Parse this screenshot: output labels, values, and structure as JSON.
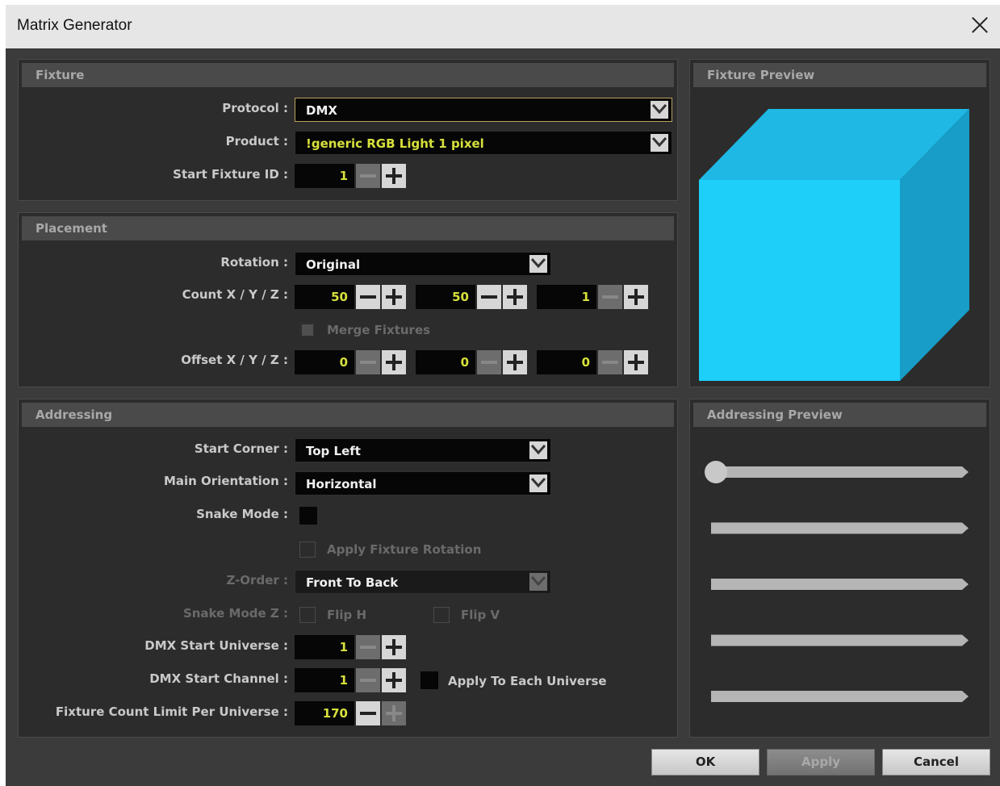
{
  "window": {
    "title": "Matrix Generator"
  },
  "fixture": {
    "header": "Fixture",
    "protocol_label": "Protocol :",
    "protocol_value": "DMX",
    "product_label": "Product :",
    "product_value": "!generic RGB Light 1 pixel",
    "start_id_label": "Start Fixture ID :",
    "start_id_value": "1"
  },
  "placement": {
    "header": "Placement",
    "rotation_label": "Rotation :",
    "rotation_value": "Original",
    "count_label": "Count X / Y / Z :",
    "count_x": "50",
    "count_y": "50",
    "count_z": "1",
    "merge_label": "Merge Fixtures",
    "offset_label": "Offset X / Y / Z :",
    "offset_x": "0",
    "offset_y": "0",
    "offset_z": "0"
  },
  "addressing": {
    "header": "Addressing",
    "start_corner_label": "Start Corner :",
    "start_corner_value": "Top Left",
    "orientation_label": "Main Orientation :",
    "orientation_value": "Horizontal",
    "snake_label": "Snake Mode :",
    "apply_rotation_label": "Apply Fixture Rotation",
    "zorder_label": "Z-Order :",
    "zorder_value": "Front To Back",
    "snake_z_label": "Snake Mode Z :",
    "flip_h_label": "Flip H",
    "flip_v_label": "Flip V",
    "universe_label": "DMX Start Universe :",
    "universe_value": "1",
    "channel_label": "DMX Start Channel :",
    "channel_value": "1",
    "apply_each_label": "Apply To Each Universe",
    "limit_label": "Fixture Count Limit Per Universe :",
    "limit_value": "170"
  },
  "fixture_preview": {
    "header": "Fixture Preview",
    "cube_front": "#1ecff9",
    "cube_top": "#1fb8e4",
    "cube_side": "#179dc8"
  },
  "addressing_preview": {
    "header": "Addressing Preview",
    "line_count": 5
  },
  "buttons": {
    "ok": "OK",
    "apply": "Apply",
    "cancel": "Cancel"
  }
}
